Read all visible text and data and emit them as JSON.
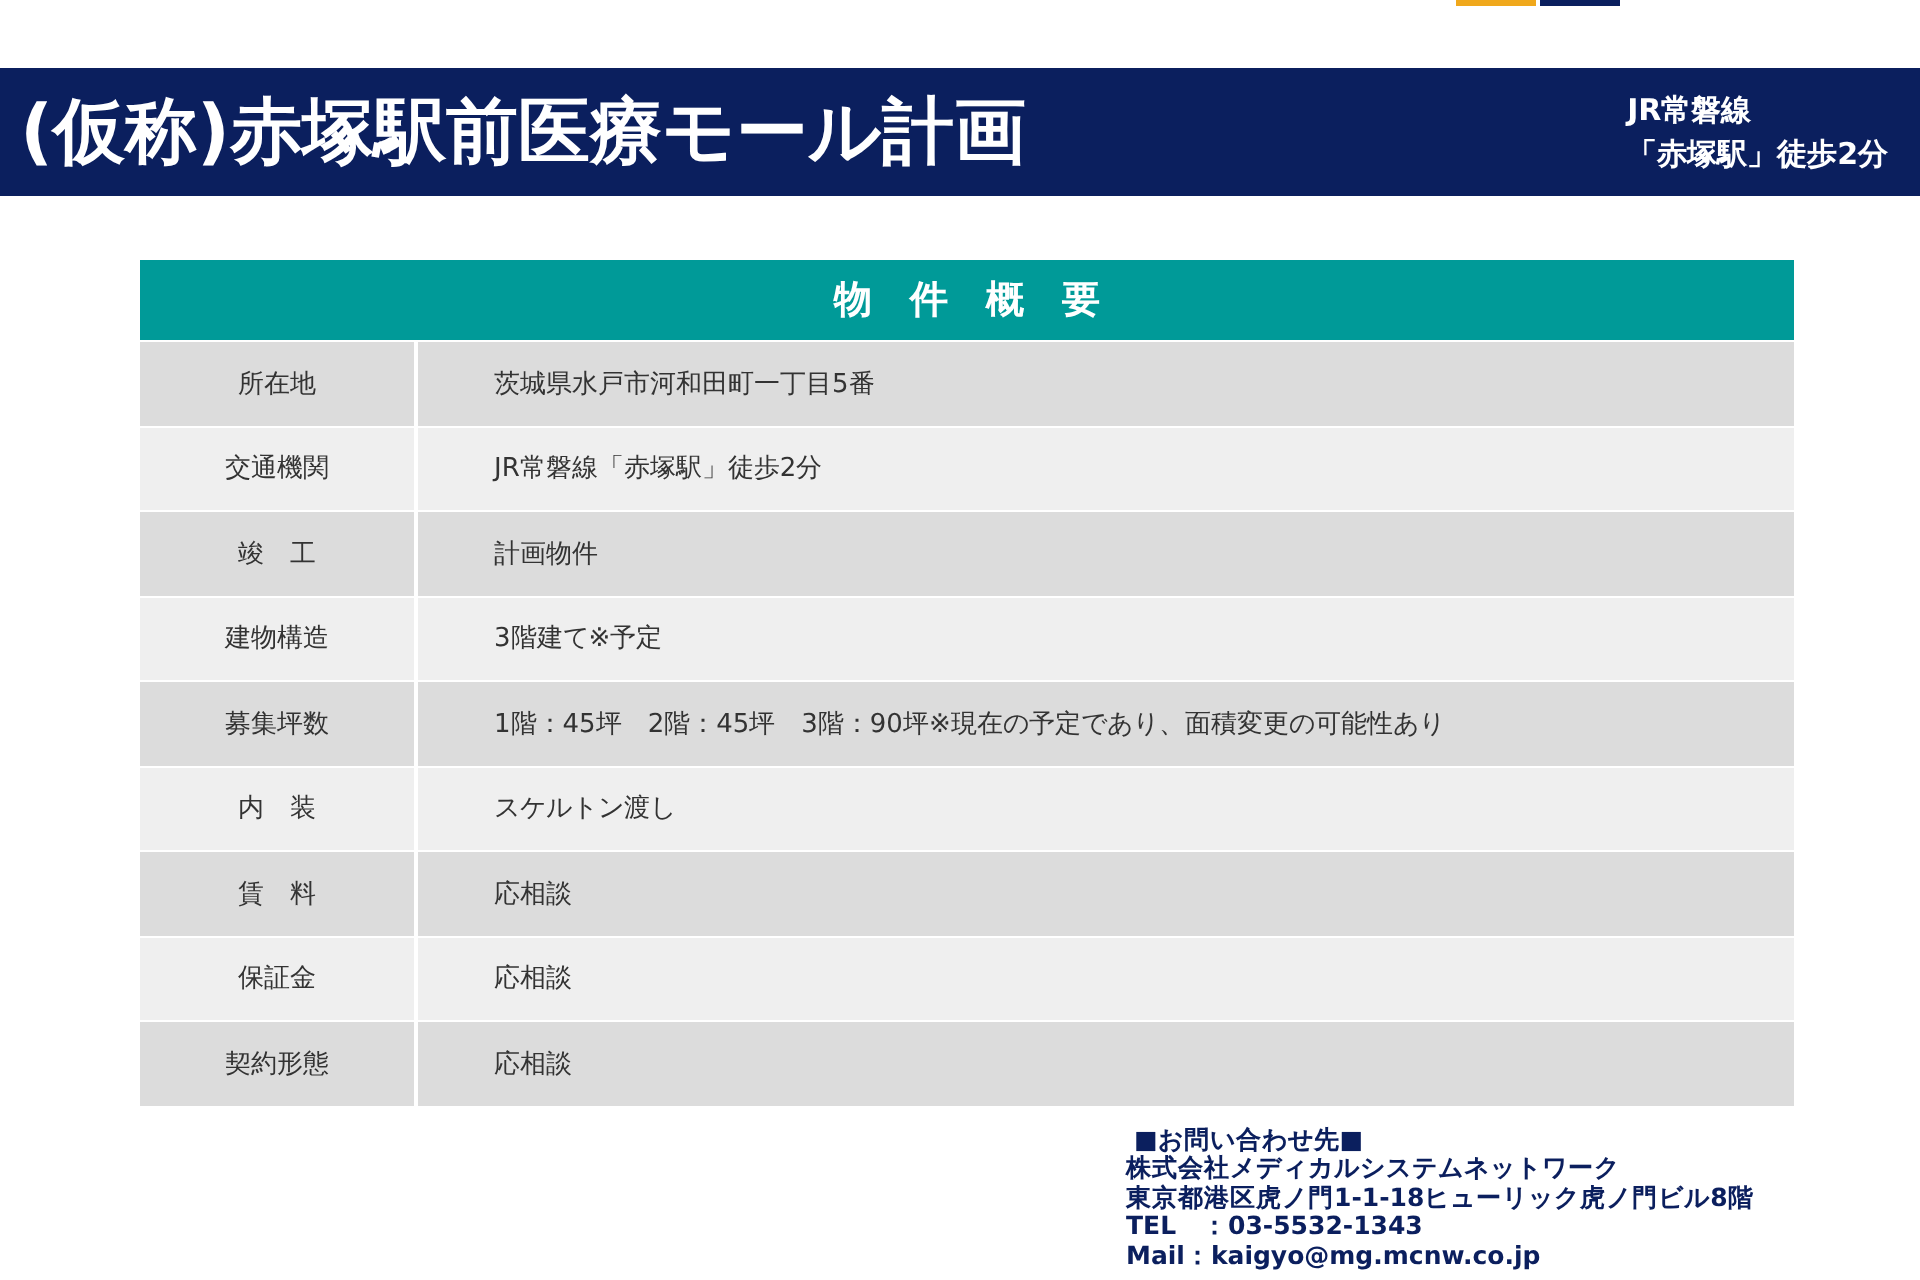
{
  "header": {
    "title": "(仮称)赤塚駅前医療モール計画",
    "access_lines": [
      "JR常磐線",
      "「赤塚駅」徒歩2分"
    ]
  },
  "table": {
    "heading": "物　件　概　要",
    "rows": [
      {
        "label": "所在地",
        "value": "茨城県水戸市河和田町一丁目5番"
      },
      {
        "label": "交通機関",
        "value": "JR常磐線「赤塚駅」徒歩2分"
      },
      {
        "label": "竣　工",
        "value": "計画物件"
      },
      {
        "label": "建物構造",
        "value": "3階建て※予定"
      },
      {
        "label": "募集坪数",
        "value": "1階：45坪　2階：45坪　3階：90坪※現在の予定であり、面積変更の可能性あり"
      },
      {
        "label": "内　装",
        "value": "スケルトン渡し"
      },
      {
        "label": "賃　料",
        "value": "応相談"
      },
      {
        "label": "保証金",
        "value": "応相談"
      },
      {
        "label": "契約形態",
        "value": "応相談"
      }
    ]
  },
  "contact": {
    "heading": "■お問い合わせ先■",
    "lines": [
      "株式会社メディカルシステムネットワーク",
      "東京都港区虎ノ門1-1-18ヒューリック虎ノ門ビル8階",
      "TEL　：03-5532-1343",
      "Mail：kaigyo@mg.mcnw.co.jp"
    ]
  }
}
